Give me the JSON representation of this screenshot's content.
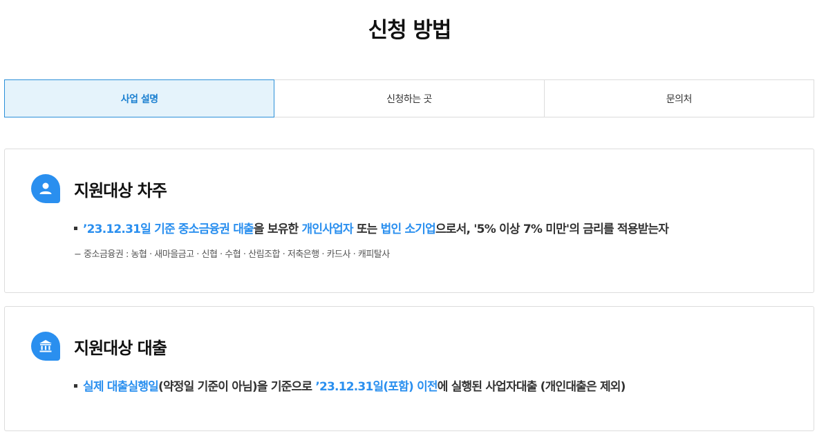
{
  "page": {
    "title": "신청 방법"
  },
  "tabs": [
    {
      "label": "사업 설명",
      "active": true
    },
    {
      "label": "신청하는 곳",
      "active": false
    },
    {
      "label": "문의처",
      "active": false
    }
  ],
  "colors": {
    "accent": "#2a8fef",
    "active_tab_bg": "#e5f3fb",
    "border": "#dcdcdc"
  },
  "borrower_card": {
    "icon": "person-icon",
    "title": "지원대상 차주",
    "line": {
      "p1": "’23.12.31일 기준 중소금융권 대출",
      "p2": "을 보유한 ",
      "p3": "개인사업자",
      "p4": " 또는 ",
      "p5": "법인 소기업",
      "p6": "으로서, '5% 이상 7% 미만'의 금리를 적용받는자"
    },
    "note": "− 중소금융권 : 농협 · 새마을금고 · 신협 · 수협 · 산림조합 · 저축은행 · 카드사 · 캐피탈사"
  },
  "loan_card": {
    "icon": "bank-icon",
    "title": "지원대상 대출",
    "line": {
      "p1": "실제 대출실행일",
      "p2": "(약정일 기준이 아님)을 기준으로 ",
      "p3": "’23.12.31일(포함) 이전",
      "p4": "에 실행된 사업자대출 (개인대출은 제외)"
    }
  }
}
